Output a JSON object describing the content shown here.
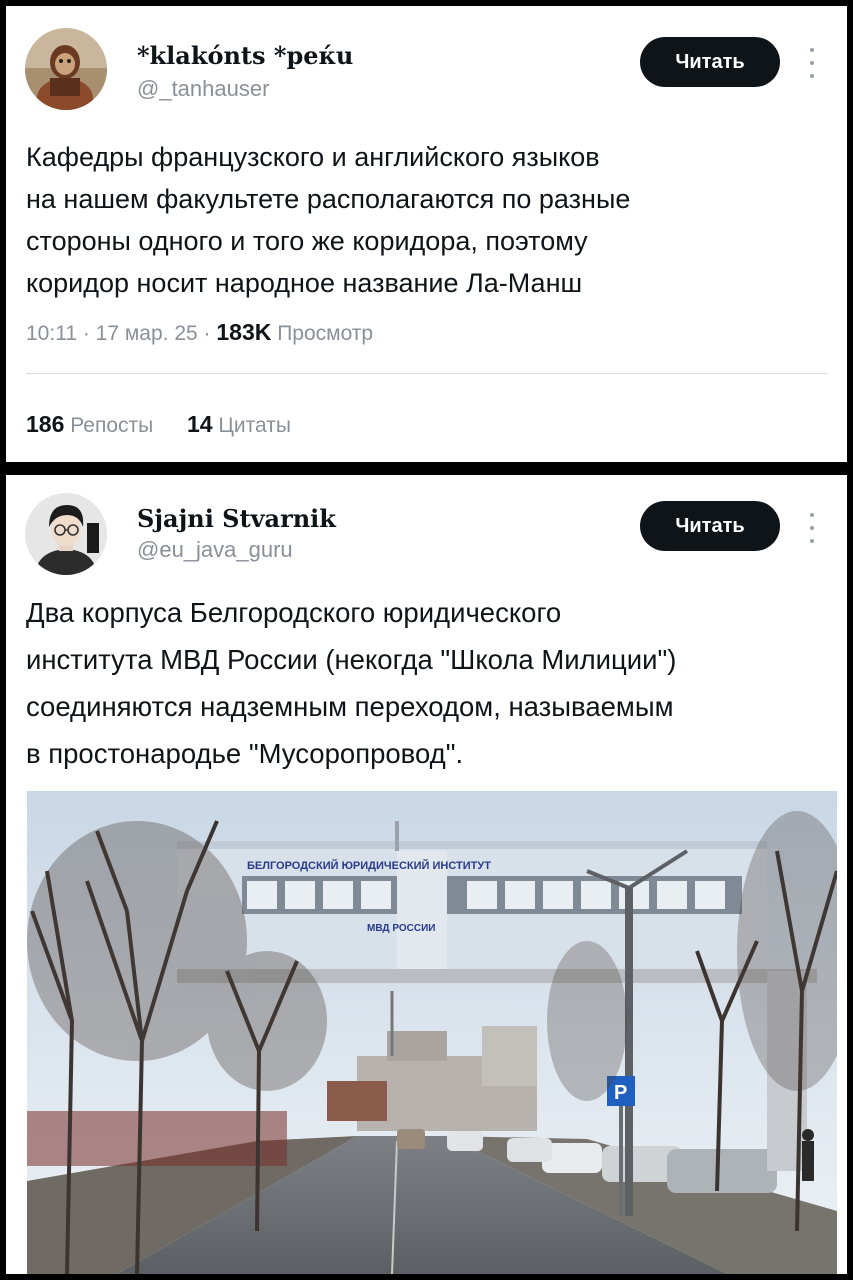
{
  "tweets": [
    {
      "display_name": "*klakónts *peќu",
      "handle": "@_tanhauser",
      "read_button": "Читать",
      "lines": [
        "Кафедры французского и английского языков",
        "на нашем факультете располагаются по разные",
        "стороны одного и того же коридора, поэтому",
        "коридор носит народное название Ла-Манш"
      ],
      "time": "10:11",
      "date": "17 мар. 25",
      "views_count": "183K",
      "views_label": "Просмотр",
      "reposts_count": "186",
      "reposts_label": "Репосты",
      "quotes_count": "14",
      "quotes_label": "Цитаты"
    },
    {
      "display_name": "Sjajni Stvarnik",
      "handle": "@eu_java_guru",
      "read_button": "Читать",
      "lines": [
        "Два корпуса Белгородского юридического",
        "института МВД России (некогда \"Школа Милиции\")",
        "соединяются надземным переходом, называемым",
        "в простонародье \"Мусоропровод\"."
      ],
      "photo": {
        "bridge_sign_top": "БЕЛГОРОДСКИЙ ЮРИДИЧЕСКИЙ ИНСТИТУТ",
        "bridge_sign_bottom": "МВД РОССИИ",
        "parking_sign": "P"
      }
    }
  ],
  "colors": {
    "text": "#0f1419",
    "secondary": "#8a9099",
    "button": "#0f1419",
    "frame": "#000000"
  }
}
